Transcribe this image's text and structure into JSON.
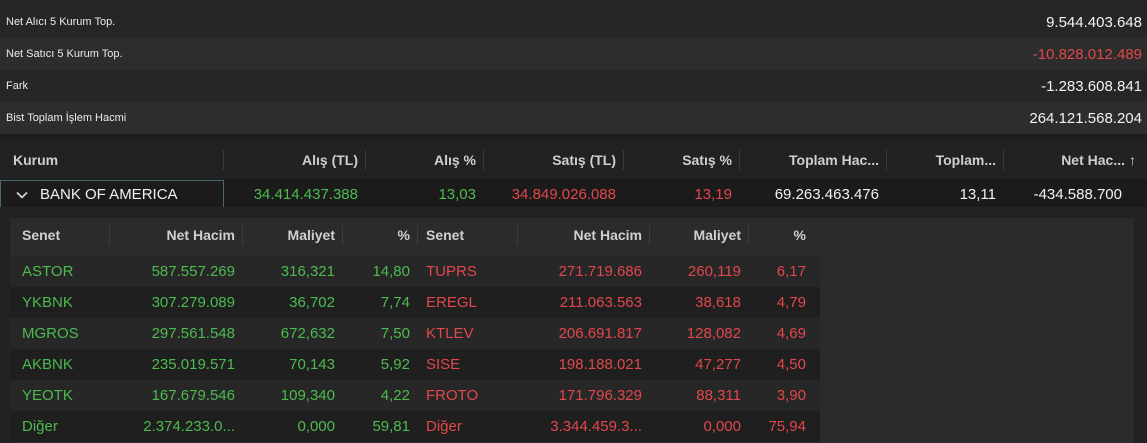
{
  "summary": [
    {
      "label": "Net Alıcı 5 Kurum Top.",
      "value": "9.544.403.648",
      "negative": false
    },
    {
      "label": "Net Satıcı 5 Kurum Top.",
      "value": "-10.828.012.489",
      "negative": true
    },
    {
      "label": "Fark",
      "value": "-1.283.608.841",
      "negative": false
    },
    {
      "label": "Bist Toplam İşlem Hacmi",
      "value": "264.121.568.204",
      "negative": false
    }
  ],
  "main_table": {
    "headers": {
      "kurum": "Kurum",
      "alis_tl": "Alış (TL)",
      "alis_pct": "Alış %",
      "satis_tl": "Satış (TL)",
      "satis_pct": "Satış %",
      "toplam_hacim": "Toplam Hac...",
      "toplam_pct": "Toplam...",
      "net_hacim": "Net Hac...",
      "sort_arrow": "↑"
    },
    "row": {
      "kurum": "BANK OF AMERICA",
      "alis_tl": "34.414.437.388",
      "alis_pct": "13,03",
      "satis_tl": "34.849.026.088",
      "satis_pct": "13,19",
      "toplam_hacim": "69.263.463.476",
      "toplam_pct": "13,11",
      "net_hacim": "-434.588.700"
    }
  },
  "detail_table": {
    "headers": {
      "senet_buy": "Senet",
      "net_hacim_buy": "Net Hacim",
      "maliyet_buy": "Maliyet",
      "pct_buy": "%",
      "senet_sell": "Senet",
      "net_hacim_sell": "Net Hacim",
      "maliyet_sell": "Maliyet",
      "pct_sell": "%"
    },
    "rows": [
      {
        "b_senet": "ASTOR",
        "b_net": "587.557.269",
        "b_mal": "316,321",
        "b_pct": "14,80",
        "s_senet": "TUPRS",
        "s_net": "271.719.686",
        "s_mal": "260,119",
        "s_pct": "6,17"
      },
      {
        "b_senet": "YKBNK",
        "b_net": "307.279.089",
        "b_mal": "36,702",
        "b_pct": "7,74",
        "s_senet": "EREGL",
        "s_net": "211.063.563",
        "s_mal": "38,618",
        "s_pct": "4,79"
      },
      {
        "b_senet": "MGROS",
        "b_net": "297.561.548",
        "b_mal": "672,632",
        "b_pct": "7,50",
        "s_senet": "KTLEV",
        "s_net": "206.691.817",
        "s_mal": "128,082",
        "s_pct": "4,69"
      },
      {
        "b_senet": "AKBNK",
        "b_net": "235.019.571",
        "b_mal": "70,143",
        "b_pct": "5,92",
        "s_senet": "SISE",
        "s_net": "198.188.021",
        "s_mal": "47,277",
        "s_pct": "4,50"
      },
      {
        "b_senet": "YEOTK",
        "b_net": "167.679.546",
        "b_mal": "109,340",
        "b_pct": "4,22",
        "s_senet": "FROTO",
        "s_net": "171.796.329",
        "s_mal": "88,311",
        "s_pct": "3,90"
      },
      {
        "b_senet": "Diğer",
        "b_net": "2.374.233.0...",
        "b_mal": "0,000",
        "b_pct": "59,81",
        "s_senet": "Diğer",
        "s_net": "3.344.459.3...",
        "s_mal": "0,000",
        "s_pct": "75,94"
      }
    ]
  },
  "colors": {
    "buy": "#4cbb4f",
    "sell": "#e2474b",
    "background": "#232323"
  },
  "icons": {
    "expand": "chevron-down-icon",
    "sort": "sort-ascending-icon"
  }
}
